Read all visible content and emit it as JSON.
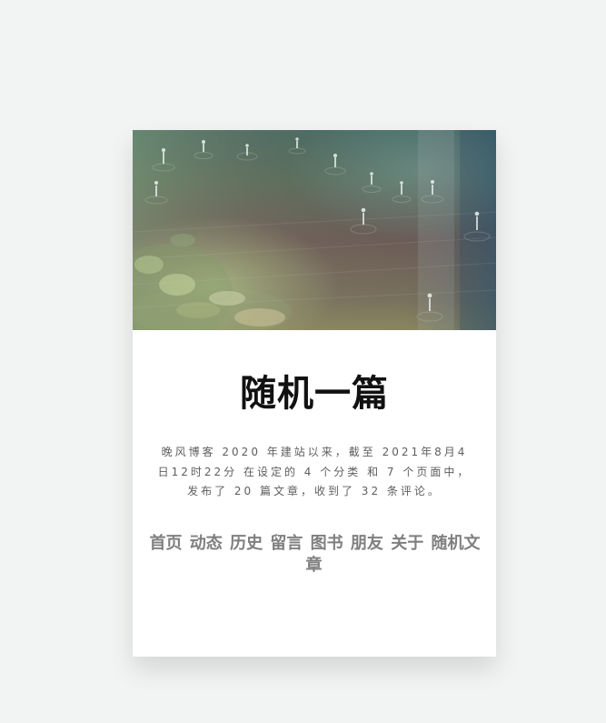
{
  "blog": {
    "title": "随机一篇",
    "description": "晚风博客 2020 年建站以来，截至 2021年8月4日12时22分 在设定的 4 个分类 和 7 个页面中， 发布了 20 篇文章，收到了 32 条评论。"
  },
  "nav": {
    "items": [
      {
        "label": "首页"
      },
      {
        "label": "动态"
      },
      {
        "label": "历史"
      },
      {
        "label": "留言"
      },
      {
        "label": "图书"
      },
      {
        "label": "朋友"
      },
      {
        "label": "关于"
      },
      {
        "label": "随机文章"
      }
    ]
  },
  "colors": {
    "page_bg": "#f2f4f3",
    "card_bg": "#ffffff",
    "title": "#111111",
    "text_muted": "#5e5e5e",
    "nav_text": "#7f7f7f"
  },
  "hero": {
    "image_name": "rain-puddle-cover"
  }
}
